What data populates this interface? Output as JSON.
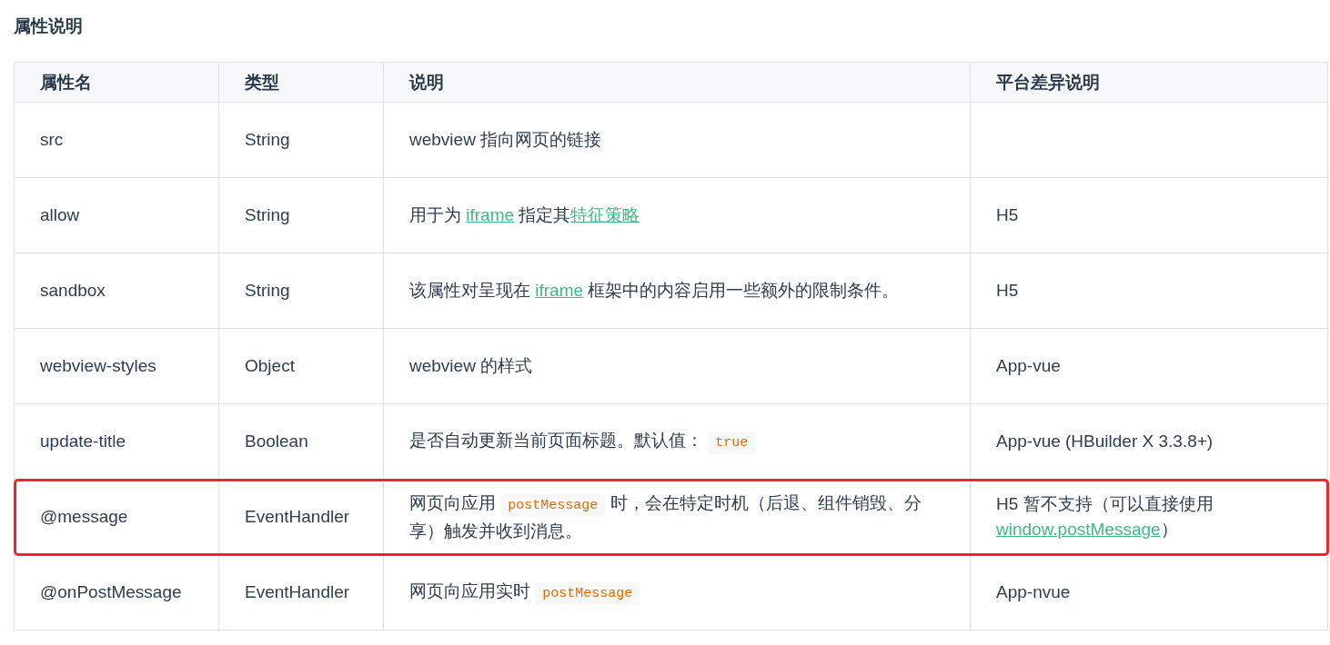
{
  "heading": "属性说明",
  "table": {
    "columns": [
      "属性名",
      "类型",
      "说明",
      "平台差异说明"
    ],
    "rows": [
      {
        "name": "src",
        "type": "String",
        "highlighted": false,
        "description": [
          {
            "kind": "text",
            "text": "webview 指向网页的链接"
          }
        ],
        "platform": []
      },
      {
        "name": "allow",
        "type": "String",
        "highlighted": false,
        "description": [
          {
            "kind": "text",
            "text": "用于为 "
          },
          {
            "kind": "link",
            "text": "iframe"
          },
          {
            "kind": "text",
            "text": " 指定其"
          },
          {
            "kind": "link",
            "text": "特征策略"
          }
        ],
        "platform": [
          {
            "kind": "text",
            "text": "H5"
          }
        ]
      },
      {
        "name": "sandbox",
        "type": "String",
        "highlighted": false,
        "description": [
          {
            "kind": "text",
            "text": "该属性对呈现在 "
          },
          {
            "kind": "link",
            "text": "iframe"
          },
          {
            "kind": "text",
            "text": " 框架中的内容启用一些额外的限制条件。"
          }
        ],
        "platform": [
          {
            "kind": "text",
            "text": "H5"
          }
        ]
      },
      {
        "name": "webview-styles",
        "type": "Object",
        "highlighted": false,
        "description": [
          {
            "kind": "text",
            "text": "webview 的样式"
          }
        ],
        "platform": [
          {
            "kind": "text",
            "text": "App-vue"
          }
        ]
      },
      {
        "name": "update-title",
        "type": "Boolean",
        "highlighted": false,
        "description": [
          {
            "kind": "text",
            "text": "是否自动更新当前页面标题。默认值： "
          },
          {
            "kind": "code",
            "text": "true"
          }
        ],
        "platform": [
          {
            "kind": "text",
            "text": "App-vue (HBuilder X 3.3.8+)"
          }
        ]
      },
      {
        "name": "@message",
        "type": "EventHandler",
        "highlighted": true,
        "description": [
          {
            "kind": "text",
            "text": "网页向应用 "
          },
          {
            "kind": "code",
            "text": "postMessage"
          },
          {
            "kind": "text",
            "text": " 时，会在特定时机（后退、组件销毁、分享）触发并收到消息。"
          }
        ],
        "platform": [
          {
            "kind": "text",
            "text": "H5 暂不支持（可以直接使用 "
          },
          {
            "kind": "link",
            "text": "window.postMessage"
          },
          {
            "kind": "text",
            "text": "）"
          }
        ]
      },
      {
        "name": "@onPostMessage",
        "type": "EventHandler",
        "highlighted": false,
        "description": [
          {
            "kind": "text",
            "text": "网页向应用实时 "
          },
          {
            "kind": "code",
            "text": "postMessage"
          }
        ],
        "platform": [
          {
            "kind": "text",
            "text": "App-nvue"
          }
        ]
      }
    ]
  }
}
